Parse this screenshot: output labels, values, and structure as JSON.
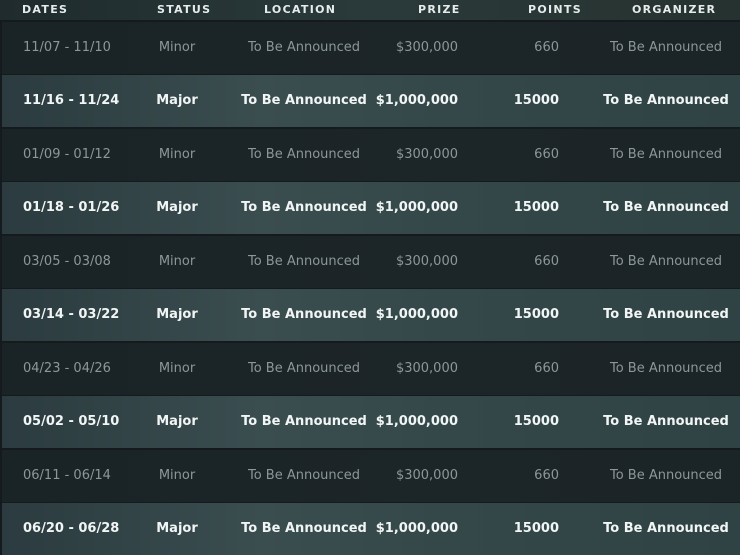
{
  "headers": {
    "dates": "DATES",
    "status": "STATUS",
    "location": "LOCATION",
    "prize": "PRIZE",
    "points": "POINTS",
    "organizer": "ORGANIZER"
  },
  "rows": [
    {
      "dates": "11/07 - 11/10",
      "status": "Minor",
      "location": "To Be Announced",
      "prize": "$300,000",
      "points": "660",
      "organizer": "To Be Announced"
    },
    {
      "dates": "11/16 - 11/24",
      "status": "Major",
      "location": "To Be Announced",
      "prize": "$1,000,000",
      "points": "15000",
      "organizer": "To Be Announced"
    },
    {
      "dates": "01/09 - 01/12",
      "status": "Minor",
      "location": "To Be Announced",
      "prize": "$300,000",
      "points": "660",
      "organizer": "To Be Announced"
    },
    {
      "dates": "01/18 - 01/26",
      "status": "Major",
      "location": "To Be Announced",
      "prize": "$1,000,000",
      "points": "15000",
      "organizer": "To Be Announced"
    },
    {
      "dates": "03/05 - 03/08",
      "status": "Minor",
      "location": "To Be Announced",
      "prize": "$300,000",
      "points": "660",
      "organizer": "To Be Announced"
    },
    {
      "dates": "03/14 - 03/22",
      "status": "Major",
      "location": "To Be Announced",
      "prize": "$1,000,000",
      "points": "15000",
      "organizer": "To Be Announced"
    },
    {
      "dates": "04/23 - 04/26",
      "status": "Minor",
      "location": "To Be Announced",
      "prize": "$300,000",
      "points": "660",
      "organizer": "To Be Announced"
    },
    {
      "dates": "05/02 - 05/10",
      "status": "Major",
      "location": "To Be Announced",
      "prize": "$1,000,000",
      "points": "15000",
      "organizer": "To Be Announced"
    },
    {
      "dates": "06/11 - 06/14",
      "status": "Minor",
      "location": "To Be Announced",
      "prize": "$300,000",
      "points": "660",
      "organizer": "To Be Announced"
    },
    {
      "dates": "06/20 - 06/28",
      "status": "Major",
      "location": "To Be Announced",
      "prize": "$1,000,000",
      "points": "15000",
      "organizer": "To Be Announced"
    }
  ]
}
